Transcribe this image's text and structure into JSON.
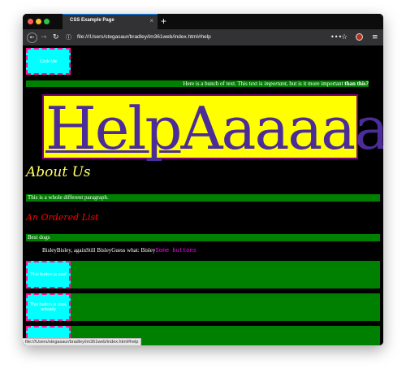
{
  "browser": {
    "tab_title": "CSS Example Page",
    "tab_close": "×",
    "new_tab": "+",
    "url": "file:///Users/stegasaur/bradley/im361web/index.html#help",
    "status_url": "file:///Users/stegasaur/bradley/im361web/index.html#help"
  },
  "page": {
    "click_me": "Click Me",
    "banner_text_before": "Here is a bunch of text. This text is ",
    "banner_em": "important",
    "banner_text_mid": ", but is it more important ",
    "banner_strong": "than this?",
    "hero_help": "Help",
    "hero_rest": "Aaaaaa",
    "about_heading": "About Us",
    "paragraph2": "This is a whole different paragraph.",
    "ordered_list_heading": "An Ordered List",
    "best_dogs": "Best dogs",
    "bisley_line": "BisleyBisley, againStill BisleyGuess what: Bisley",
    "some_buttons": "Some buttons",
    "button1": "This button is cool",
    "button2": "This button is cool, actually"
  },
  "colors": {
    "background": "#000000",
    "green": "#008000",
    "cyan": "#00ffff",
    "pink_border": "#ff1493",
    "yellow": "#ffff00",
    "purple": "#4b2c99",
    "red": "#ff0000",
    "magenta": "#ff00ff"
  }
}
